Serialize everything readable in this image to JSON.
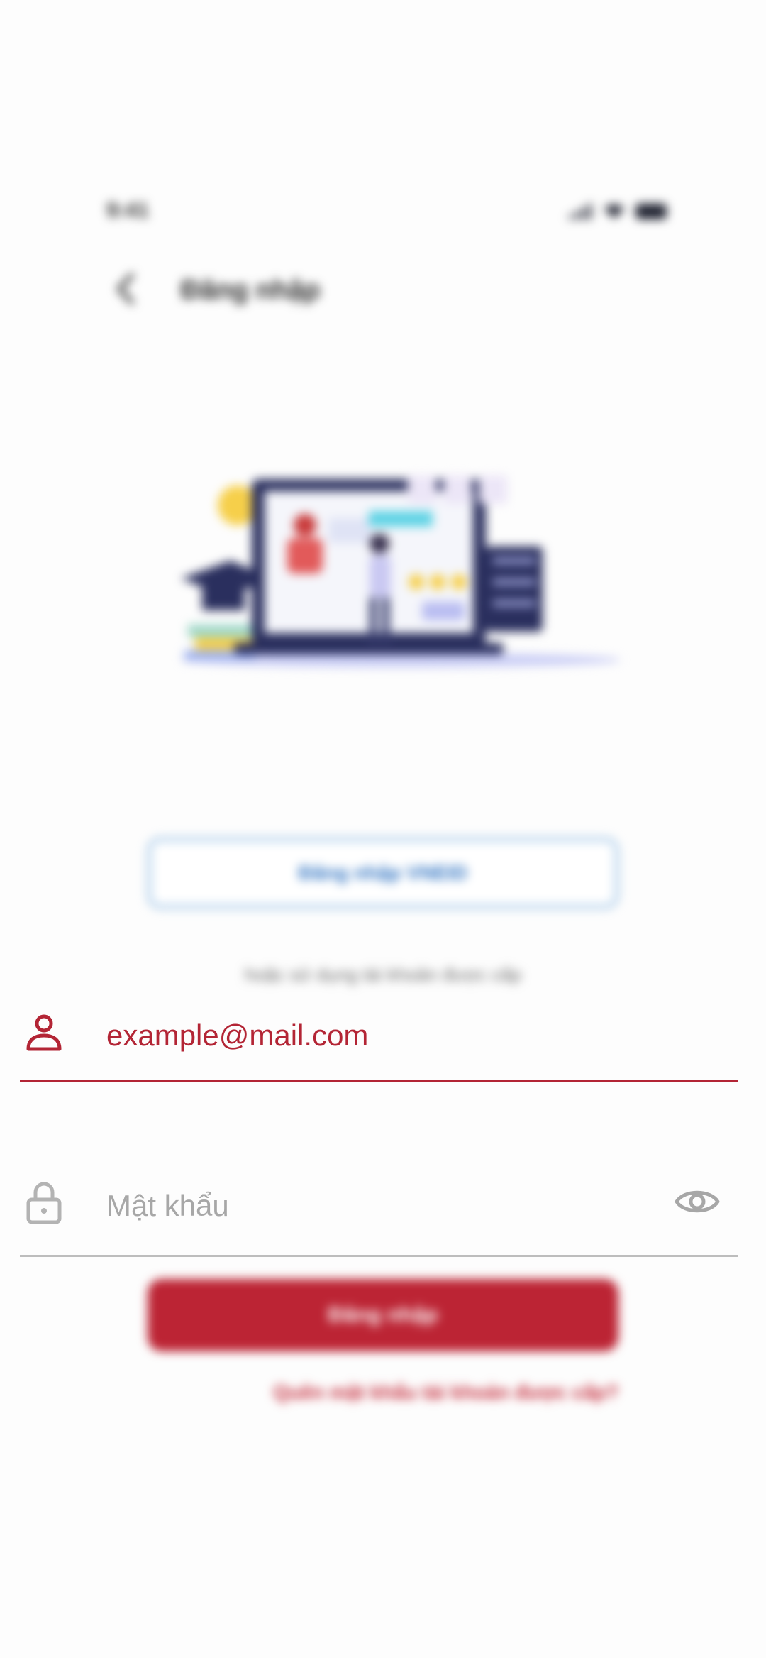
{
  "status_bar": {
    "time": "9:41",
    "icons": [
      "signal-icon",
      "wifi-icon",
      "battery-icon"
    ]
  },
  "header": {
    "back_icon": "chevron-left-icon",
    "title": "Đăng nhập"
  },
  "illustration": {
    "icon": "online-learning-illustration"
  },
  "vneid_button": {
    "label": "Đăng nhập VNEID"
  },
  "divider_text": "hoặc sử dụng tài khoản được cấp",
  "email_field": {
    "icon": "user-icon",
    "value": "example@mail.com"
  },
  "password_field": {
    "icon": "lock-icon",
    "placeholder": "Mật khẩu",
    "value": "",
    "toggle_icon": "eye-icon"
  },
  "login_button": {
    "label": "Đăng nhập"
  },
  "forgot_link": {
    "label": "Quên mật khẩu tài khoản được cấp?"
  },
  "colors": {
    "accent": "#bc2434",
    "vneid_border": "#9dc3e6",
    "vneid_text": "#2f73c2",
    "underline_inactive": "#bdbdbd"
  }
}
